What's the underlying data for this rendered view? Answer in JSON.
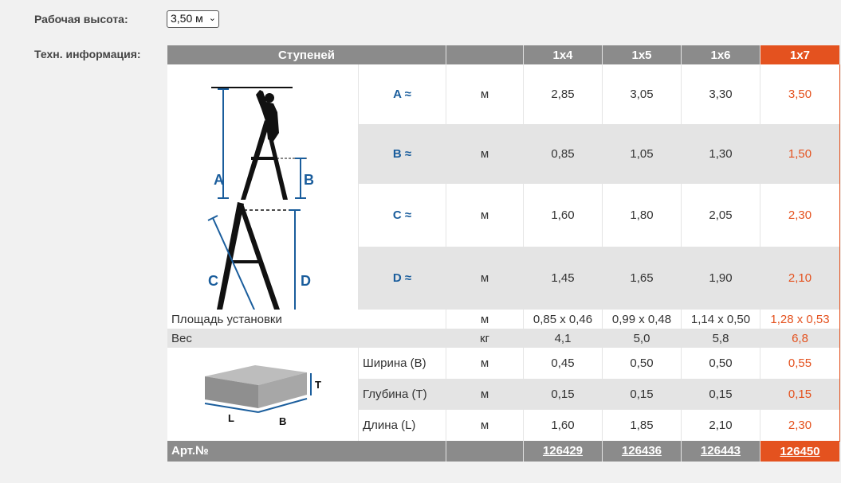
{
  "form": {
    "height_label": "Рабочая высота:",
    "height_value": "3,50 м",
    "tech_label": "Техн. информация:"
  },
  "table": {
    "header_steps": "Ступеней",
    "columns": [
      "1x4",
      "1x5",
      "1x6",
      "1x7"
    ],
    "dims": [
      {
        "label": "A ≈",
        "unit": "м",
        "values": [
          "2,85",
          "3,05",
          "3,30",
          "3,50"
        ]
      },
      {
        "label": "B ≈",
        "unit": "м",
        "values": [
          "0,85",
          "1,05",
          "1,30",
          "1,50"
        ]
      },
      {
        "label": "C ≈",
        "unit": "м",
        "values": [
          "1,60",
          "1,80",
          "2,05",
          "2,30"
        ]
      },
      {
        "label": "D ≈",
        "unit": "м",
        "values": [
          "1,45",
          "1,65",
          "1,90",
          "2,10"
        ]
      }
    ],
    "area": {
      "label": "Площадь установки",
      "unit": "м",
      "values": [
        "0,85 x 0,46",
        "0,99 x 0,48",
        "1,14 x 0,50",
        "1,28 x 0,53"
      ]
    },
    "weight": {
      "label": "Вес",
      "unit": "кг",
      "values": [
        "4,1",
        "5,0",
        "5,8",
        "6,8"
      ]
    },
    "package": [
      {
        "label": "Ширина (B)",
        "unit": "м",
        "values": [
          "0,45",
          "0,50",
          "0,50",
          "0,55"
        ]
      },
      {
        "label": "Глубина (T)",
        "unit": "м",
        "values": [
          "0,15",
          "0,15",
          "0,15",
          "0,15"
        ]
      },
      {
        "label": "Длина (L)",
        "unit": "м",
        "values": [
          "1,60",
          "1,85",
          "2,10",
          "2,30"
        ]
      }
    ],
    "art_label": "Арт.№",
    "art_numbers": [
      "126429",
      "126436",
      "126443",
      "126450"
    ]
  },
  "diagram_letters": {
    "a": "A",
    "b": "B",
    "c": "C",
    "d": "D",
    "t": "T",
    "l": "L",
    "b2": "B"
  },
  "colors": {
    "accent": "#e4521f",
    "dim_blue": "#1a5d9c",
    "header_gray": "#8b8b8b"
  }
}
